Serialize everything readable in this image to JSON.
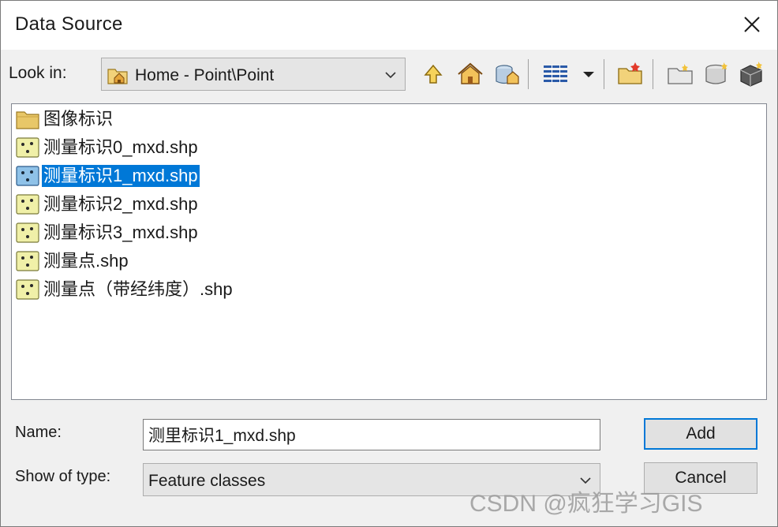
{
  "window": {
    "title": "Data Source"
  },
  "lookin": {
    "label": "Look in:",
    "value": "Home - Point\\Point"
  },
  "toolbar": {
    "icons": [
      "up-one-level-icon",
      "home-icon",
      "connect-folder-icon",
      "list-view-icon",
      "view-dropdown-icon",
      "new-folder-icon",
      "new-file-geodatabase-icon",
      "new-database-icon",
      "add-database-connection-icon"
    ]
  },
  "files": [
    {
      "name": "图像标识",
      "kind": "folder"
    },
    {
      "name": "测量标识0_mxd.shp",
      "kind": "shapefile"
    },
    {
      "name": "测量标识1_mxd.shp",
      "kind": "shapefile",
      "selected": true
    },
    {
      "name": "测量标识2_mxd.shp",
      "kind": "shapefile"
    },
    {
      "name": "测量标识3_mxd.shp",
      "kind": "shapefile"
    },
    {
      "name": "测量点.shp",
      "kind": "shapefile"
    },
    {
      "name": "测量点（带经纬度）.shp",
      "kind": "shapefile"
    }
  ],
  "name_field": {
    "label": "Name:",
    "value": "测里标识1_mxd.shp"
  },
  "type_field": {
    "label": "Show of type:",
    "value": "Feature classes"
  },
  "buttons": {
    "add": "Add",
    "cancel": "Cancel"
  },
  "watermark": "CSDN @疯狂学习GIS",
  "colors": {
    "selection": "#0078d7",
    "folder": "#e8c768",
    "shapefile": "#f0f0a8",
    "dialog_bg": "#f0f0f0"
  }
}
